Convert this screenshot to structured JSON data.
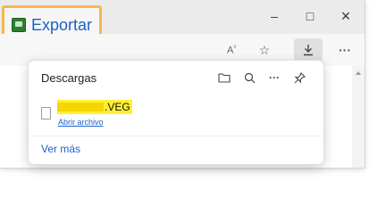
{
  "app": {
    "export_label": "Exportar"
  },
  "window_controls": {
    "minimize": "–",
    "maximize": "□",
    "close": "×"
  },
  "toolbar": {
    "read_aloud_glyph": "A\u0011",
    "favorite_glyph": "☆",
    "downloads_glyph": "⤓",
    "more_glyph": "···"
  },
  "downloads": {
    "title": "Descargas",
    "items": [
      {
        "name_suffix": ".VEG",
        "action": "Abrir archivo"
      }
    ],
    "see_more": "Ver más",
    "icons": [
      "folder-icon",
      "search-icon",
      "more-options-icon",
      "pin-icon"
    ]
  },
  "colors": {
    "highlight_yellow": "#ffef33",
    "link_blue": "#1a62c9",
    "export_border": "#f5b84a"
  }
}
